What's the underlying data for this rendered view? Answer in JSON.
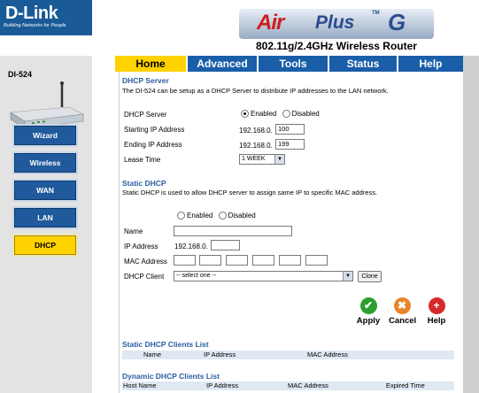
{
  "header": {
    "logo": "D-Link",
    "logo_tagline": "Building Networks for People",
    "brand_air": "Air",
    "brand_plus": "Plus",
    "brand_tm": "TM",
    "brand_g": "G",
    "subtitle": "802.11g/2.4GHz Wireless Router"
  },
  "sidebar": {
    "model": "DI-524",
    "items": [
      {
        "label": "Wizard"
      },
      {
        "label": "Wireless"
      },
      {
        "label": "WAN"
      },
      {
        "label": "LAN"
      },
      {
        "label": "DHCP"
      }
    ]
  },
  "tabs": [
    {
      "label": "Home"
    },
    {
      "label": "Advanced"
    },
    {
      "label": "Tools"
    },
    {
      "label": "Status"
    },
    {
      "label": "Help"
    }
  ],
  "dhcp_server": {
    "title": "DHCP Server",
    "description": "The DI-524 can be setup as a DHCP Server to distribute IP addresses to the LAN network.",
    "server_label": "DHCP Server",
    "enabled_label": "Enabled",
    "disabled_label": "Disabled",
    "start_label": "Starting IP Address",
    "start_prefix": "192.168.0.",
    "start_value": "100",
    "end_label": "Ending IP Address",
    "end_prefix": "192.168.0.",
    "end_value": "199",
    "lease_label": "Lease Time",
    "lease_value": "1 WEEK"
  },
  "static_dhcp": {
    "title": "Static DHCP",
    "description": "Static DHCP is used to allow DHCP server to assign same IP to specific MAC address.",
    "enabled_label": "Enabled",
    "disabled_label": "Disabled",
    "name_label": "Name",
    "ip_label": "IP Address",
    "ip_prefix": "192.168.0.",
    "mac_label": "MAC Address",
    "client_label": "DHCP Client",
    "client_value": "-- select one --",
    "clone_label": "Clone"
  },
  "actions": {
    "apply": "Apply",
    "cancel": "Cancel",
    "help": "Help"
  },
  "static_list": {
    "title": "Static DHCP Clients List",
    "columns": [
      "Name",
      "IP Address",
      "MAC Address"
    ]
  },
  "dynamic_list": {
    "title": "Dynamic DHCP Clients List",
    "columns": [
      "Host Name",
      "IP Address",
      "MAC Address",
      "Expired Time"
    ]
  },
  "colors": {
    "accent_blue": "#1a5ea8",
    "active_yellow": "#ffd200",
    "section_title": "#2b5da1"
  }
}
